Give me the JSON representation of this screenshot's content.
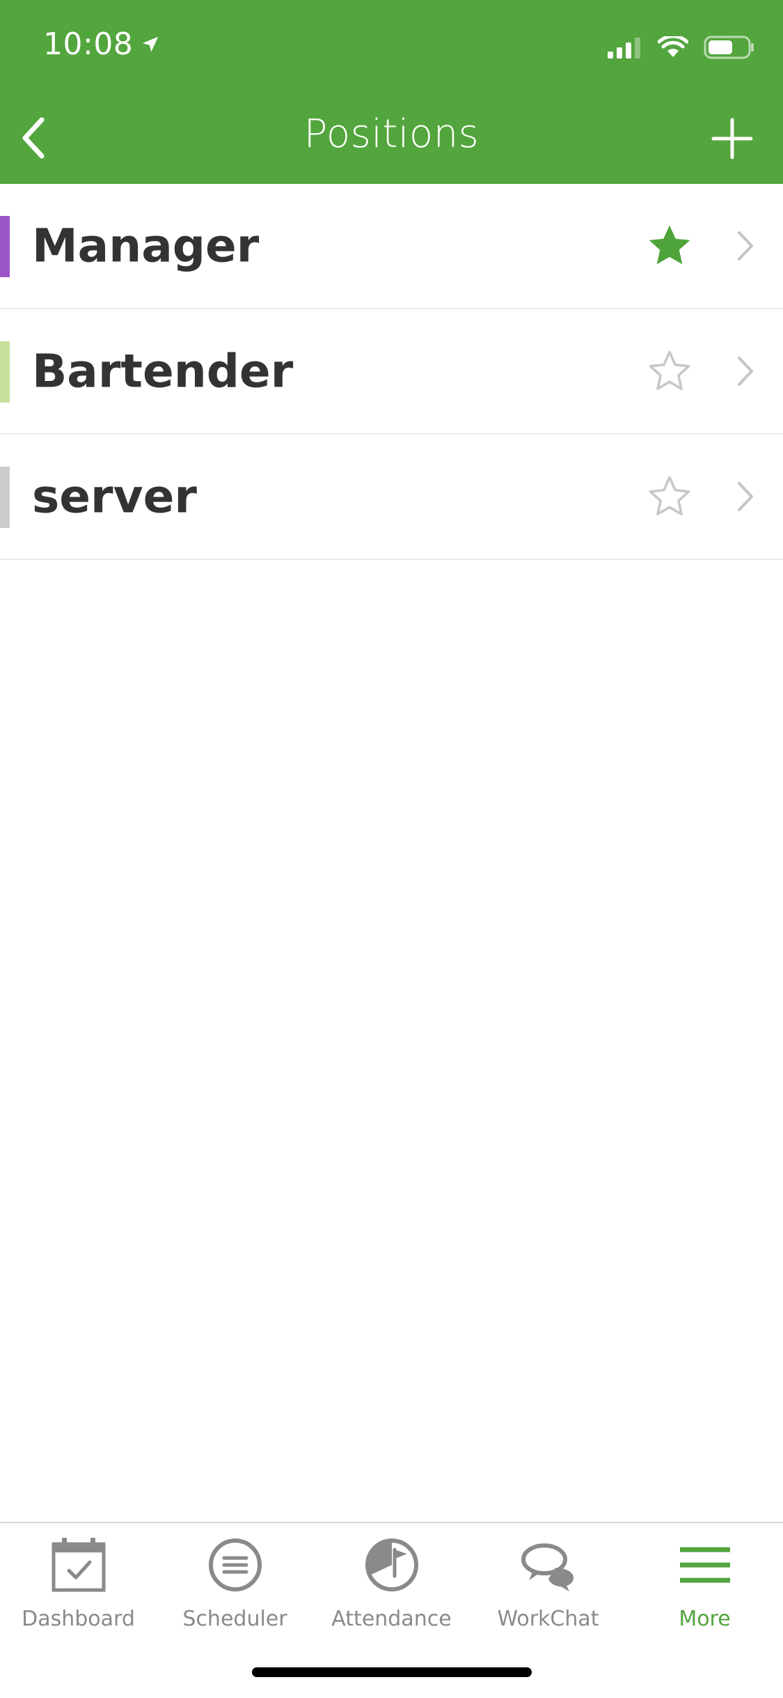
{
  "status_bar": {
    "time": "10:08",
    "location_icon": "location-arrow-icon",
    "signal_icon": "cellular-signal-icon",
    "wifi_icon": "wifi-icon",
    "battery_icon": "battery-icon"
  },
  "nav": {
    "title": "Positions",
    "back_icon": "chevron-left-icon",
    "add_icon": "plus-icon"
  },
  "positions": [
    {
      "name": "Manager",
      "color": "#9b55c8",
      "favorite": true
    },
    {
      "name": "Bartender",
      "color": "#c6e09a",
      "favorite": false
    },
    {
      "name": "server",
      "color": "#cccccc",
      "favorite": false
    }
  ],
  "tabs": [
    {
      "label": "Dashboard",
      "icon": "calendar-check-icon",
      "active": false
    },
    {
      "label": "Scheduler",
      "icon": "scheduler-lines-icon",
      "active": false
    },
    {
      "label": "Attendance",
      "icon": "attendance-clock-icon",
      "active": false
    },
    {
      "label": "WorkChat",
      "icon": "chat-bubbles-icon",
      "active": false
    },
    {
      "label": "More",
      "icon": "hamburger-menu-icon",
      "active": true
    }
  ],
  "colors": {
    "brand_green": "#53a53d",
    "favorite_star": "#4ea43a",
    "inactive_star": "#c8c8c8",
    "chevron": "#c4c4c4",
    "tab_inactive": "#8a8a8a",
    "text_primary": "#333333"
  }
}
